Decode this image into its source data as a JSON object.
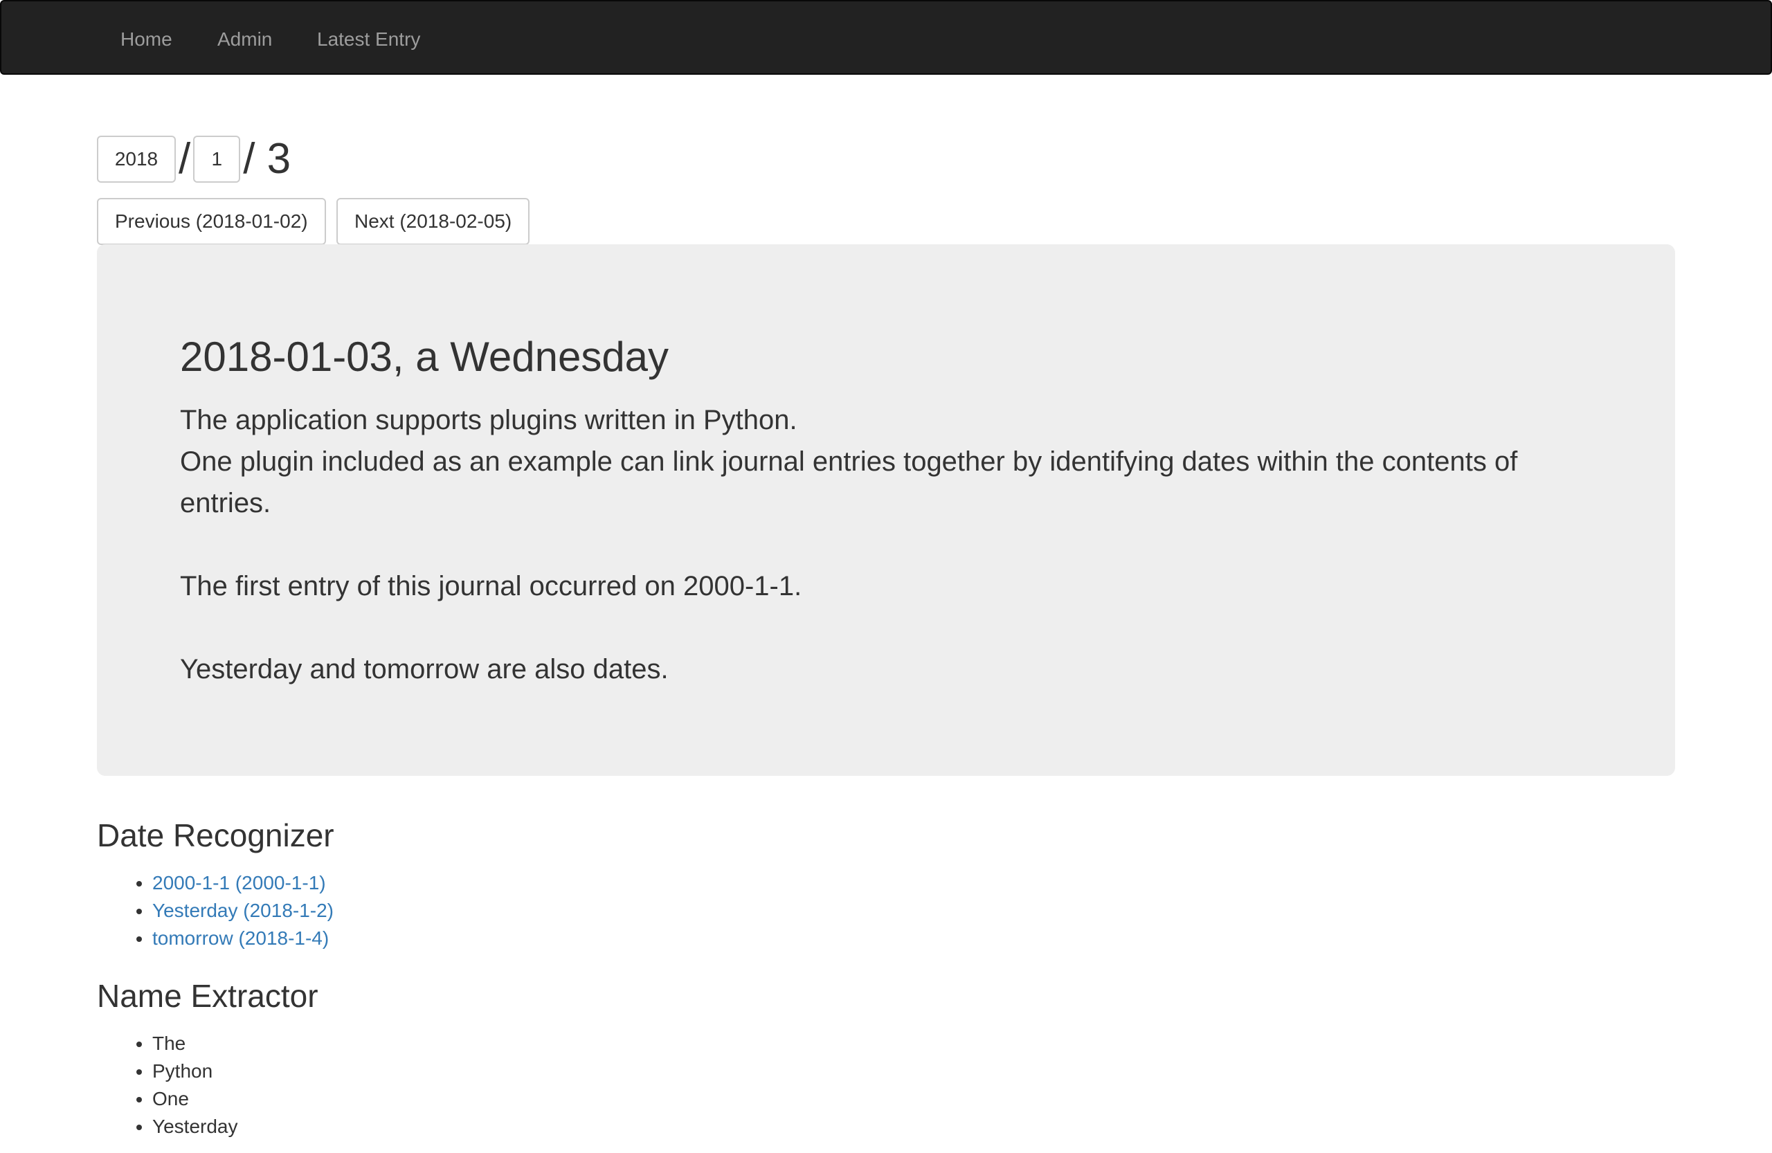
{
  "nav": {
    "items": [
      "Home",
      "Admin",
      "Latest Entry"
    ]
  },
  "date_selector": {
    "year": "2018",
    "month": "1",
    "separator": "/",
    "day_label": "/ 3"
  },
  "pager": {
    "previous_label": "Previous (2018-01-02)",
    "next_label": "Next (2018-02-05)"
  },
  "entry": {
    "title": "2018-01-03, a Wednesday",
    "line1": "The application supports plugins written in Python.",
    "line2": "One plugin included as an example can link journal entries together by identifying dates within the contents of entries.",
    "line3": "The first entry of this journal occurred on 2000-1-1.",
    "line4": "Yesterday and tomorrow are also dates."
  },
  "date_recognizer": {
    "title": "Date Recognizer",
    "links": [
      "2000-1-1 (2000-1-1)",
      "Yesterday (2018-1-2)",
      "tomorrow (2018-1-4)"
    ]
  },
  "name_extractor": {
    "title": "Name Extractor",
    "names": [
      "The",
      "Python",
      "One",
      "Yesterday"
    ]
  },
  "colors": {
    "navbar_bg": "#222222",
    "nav_text": "#9d9d9d",
    "jumbotron_bg": "#eeeeee",
    "link": "#337ab7",
    "text": "#333333"
  }
}
